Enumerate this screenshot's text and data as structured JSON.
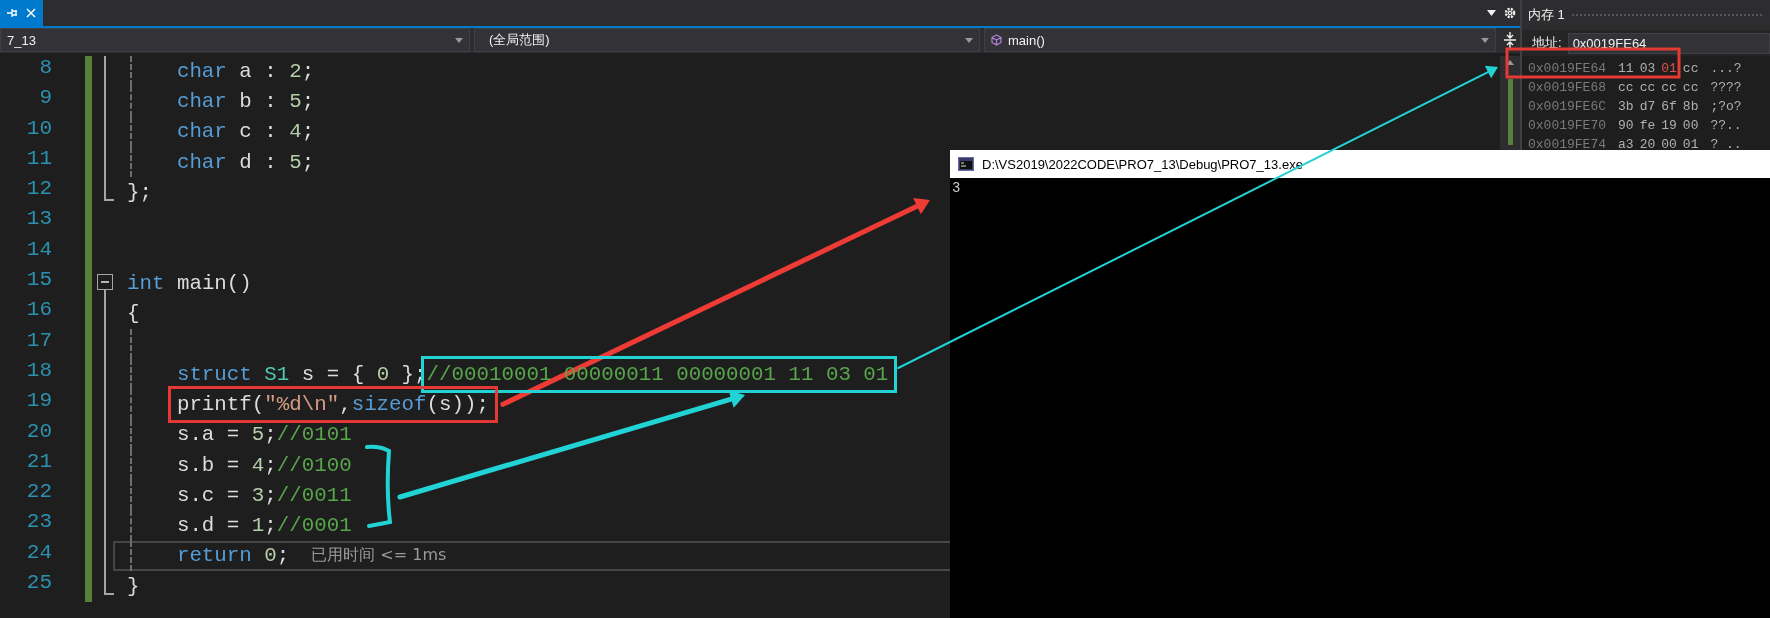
{
  "navigation_bar": {
    "project": "7_13",
    "scope": "(全局范围)",
    "member": "main()"
  },
  "code_lines": [
    {
      "number": "8",
      "kind": "body",
      "indented": true,
      "current": false,
      "tokens": [
        {
          "kind": "keyword",
          "text": "char"
        },
        {
          "kind": "plain",
          "text": " a : "
        },
        {
          "kind": "number",
          "text": "2"
        },
        {
          "kind": "plain",
          "text": ";"
        }
      ]
    },
    {
      "number": "9",
      "kind": "body",
      "indented": true,
      "current": false,
      "tokens": [
        {
          "kind": "keyword",
          "text": "char"
        },
        {
          "kind": "plain",
          "text": " b : "
        },
        {
          "kind": "number",
          "text": "5"
        },
        {
          "kind": "plain",
          "text": ";"
        }
      ]
    },
    {
      "number": "10",
      "kind": "body",
      "indented": true,
      "current": false,
      "tokens": [
        {
          "kind": "keyword",
          "text": "char"
        },
        {
          "kind": "plain",
          "text": " c : "
        },
        {
          "kind": "number",
          "text": "4"
        },
        {
          "kind": "plain",
          "text": ";"
        }
      ]
    },
    {
      "number": "11",
      "kind": "body",
      "indented": true,
      "current": false,
      "tokens": [
        {
          "kind": "keyword",
          "text": "char"
        },
        {
          "kind": "plain",
          "text": " d : "
        },
        {
          "kind": "number",
          "text": "5"
        },
        {
          "kind": "plain",
          "text": ";"
        }
      ]
    },
    {
      "number": "12",
      "kind": "end",
      "current": false,
      "tokens": [
        {
          "kind": "plain",
          "text": "};"
        }
      ]
    },
    {
      "number": "13",
      "kind": "blank",
      "current": false
    },
    {
      "number": "14",
      "kind": "blank",
      "current": false
    },
    {
      "number": "15",
      "kind": "start",
      "expanded": true,
      "current": false,
      "tokens": [
        {
          "kind": "keyword",
          "text": "int"
        },
        {
          "kind": "plain",
          "text": " main()"
        }
      ]
    },
    {
      "number": "16",
      "kind": "body",
      "current": false,
      "tokens": [
        {
          "kind": "plain",
          "text": "{"
        }
      ]
    },
    {
      "number": "17",
      "kind": "gap",
      "current": false
    },
    {
      "number": "18",
      "kind": "body",
      "indented": true,
      "current": false,
      "tokens": [
        {
          "kind": "keyword",
          "text": "struct "
        },
        {
          "kind": "type",
          "text": "S1"
        },
        {
          "kind": "plain",
          "text": " s = { "
        },
        {
          "kind": "number",
          "text": "0"
        },
        {
          "kind": "plain",
          "text": " };"
        },
        {
          "kind": "comment",
          "text": "//00010001 00000011 00000001 11 03 01"
        }
      ]
    },
    {
      "number": "19",
      "kind": "body",
      "indented": true,
      "current": false,
      "tokens": [
        {
          "kind": "plain",
          "text": "printf("
        },
        {
          "kind": "string",
          "text": "\"%d\\n\""
        },
        {
          "kind": "plain",
          "text": ","
        },
        {
          "kind": "keyword",
          "text": "sizeof"
        },
        {
          "kind": "plain",
          "text": "(s));"
        }
      ]
    },
    {
      "number": "20",
      "kind": "body",
      "indented": true,
      "current": false,
      "tokens": [
        {
          "kind": "plain",
          "text": "s.a = "
        },
        {
          "kind": "number",
          "text": "5"
        },
        {
          "kind": "plain",
          "text": ";"
        },
        {
          "kind": "comment",
          "text": "//0101"
        }
      ]
    },
    {
      "number": "21",
      "kind": "body",
      "indented": true,
      "current": false,
      "tokens": [
        {
          "kind": "plain",
          "text": "s.b = "
        },
        {
          "kind": "number",
          "text": "4"
        },
        {
          "kind": "plain",
          "text": ";"
        },
        {
          "kind": "comment",
          "text": "//0100"
        }
      ]
    },
    {
      "number": "22",
      "kind": "body",
      "indented": true,
      "current": false,
      "tokens": [
        {
          "kind": "plain",
          "text": "s.c = "
        },
        {
          "kind": "number",
          "text": "3"
        },
        {
          "kind": "plain",
          "text": ";"
        },
        {
          "kind": "comment",
          "text": "//0011"
        }
      ]
    },
    {
      "number": "23",
      "kind": "body",
      "indented": true,
      "current": false,
      "tokens": [
        {
          "kind": "plain",
          "text": "s.d = "
        },
        {
          "kind": "number",
          "text": "1"
        },
        {
          "kind": "plain",
          "text": ";"
        },
        {
          "kind": "comment",
          "text": "//0001"
        }
      ]
    },
    {
      "number": "24",
      "kind": "body",
      "indented": true,
      "current": true,
      "hint": "已用时间 <= 1ms",
      "tokens": [
        {
          "kind": "keyword",
          "text": "return "
        },
        {
          "kind": "number",
          "text": "0"
        },
        {
          "kind": "plain",
          "text": ";"
        }
      ]
    },
    {
      "number": "25",
      "kind": "end",
      "current": false,
      "tokens": [
        {
          "kind": "plain",
          "text": "}"
        }
      ]
    }
  ],
  "memory_window": {
    "title": "内存 1",
    "address_label": "地址:",
    "address": "0x0019FE64",
    "rows": [
      {
        "address": "0x0019FE64",
        "bytes": [
          {
            "value": "11",
            "changed": false
          },
          {
            "value": "03",
            "changed": false
          },
          {
            "value": "01",
            "changed": true
          },
          {
            "value": "cc",
            "changed": false
          }
        ],
        "ascii": "...?"
      },
      {
        "address": "0x0019FE68",
        "bytes": [
          {
            "value": "cc",
            "changed": false
          },
          {
            "value": "cc",
            "changed": false
          },
          {
            "value": "cc",
            "changed": false
          },
          {
            "value": "cc",
            "changed": false
          }
        ],
        "ascii": "????"
      },
      {
        "address": "0x0019FE6C",
        "bytes": [
          {
            "value": "3b",
            "changed": false
          },
          {
            "value": "d7",
            "changed": false
          },
          {
            "value": "6f",
            "changed": false
          },
          {
            "value": "8b",
            "changed": false
          }
        ],
        "ascii": ";?o?"
      },
      {
        "address": "0x0019FE70",
        "bytes": [
          {
            "value": "90",
            "changed": false
          },
          {
            "value": "fe",
            "changed": false
          },
          {
            "value": "19",
            "changed": false
          },
          {
            "value": "00",
            "changed": false
          }
        ],
        "ascii": "??.."
      },
      {
        "address": "0x0019FE74",
        "bytes": [
          {
            "value": "a3",
            "changed": false
          },
          {
            "value": "20",
            "changed": false
          },
          {
            "value": "00",
            "changed": false
          },
          {
            "value": "01",
            "changed": false
          }
        ],
        "ascii": "? .."
      }
    ]
  },
  "console_window": {
    "title": "D:\\VS2019\\2022CODE\\PRO7_13\\Debug\\PRO7_13.exe",
    "output": "3"
  }
}
